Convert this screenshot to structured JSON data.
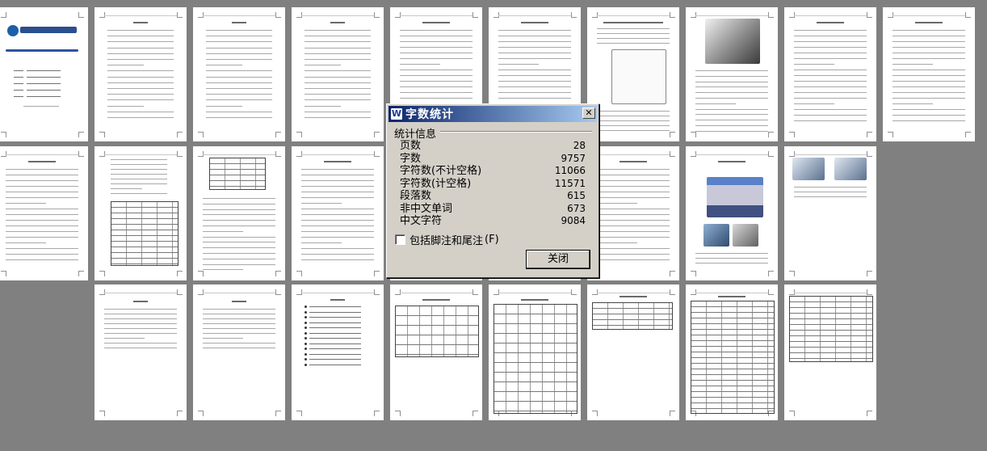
{
  "dialog": {
    "title": "字数统计",
    "section_label": "统计信息",
    "stats": [
      {
        "label": "页数",
        "value": "28"
      },
      {
        "label": "字数",
        "value": "9757"
      },
      {
        "label": "字符数(不计空格)",
        "value": "11066"
      },
      {
        "label": "字符数(计空格)",
        "value": "11571"
      },
      {
        "label": "段落数",
        "value": "615"
      },
      {
        "label": "非中文单词",
        "value": "673"
      },
      {
        "label": "中文字符",
        "value": "9084"
      }
    ],
    "checkbox_label": "包括脚注和尾注",
    "checkbox_hotkey": "(F)",
    "checkbox_checked": false,
    "close_label": "关闭",
    "close_glyph": "✕",
    "app_icon_glyph": "W"
  },
  "document": {
    "page_count_shown": 28
  }
}
